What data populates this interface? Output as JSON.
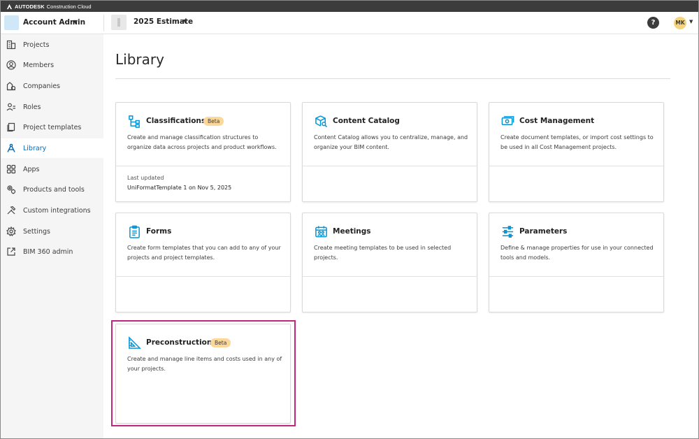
{
  "brand": {
    "name": "AUTODESK",
    "product": "Construction Cloud"
  },
  "header": {
    "account_name": "Account Admin",
    "project_name": "2025 Estimate",
    "help_label": "?",
    "user_initials": "MK"
  },
  "sidebar": {
    "items": [
      {
        "label": "Projects",
        "icon": "building-icon",
        "active": false
      },
      {
        "label": "Members",
        "icon": "person-circle-icon",
        "active": false
      },
      {
        "label": "Companies",
        "icon": "companies-icon",
        "active": false
      },
      {
        "label": "Roles",
        "icon": "roles-icon",
        "active": false
      },
      {
        "label": "Project templates",
        "icon": "template-icon",
        "active": false
      },
      {
        "label": "Library",
        "icon": "library-icon",
        "active": true
      },
      {
        "label": "Apps",
        "icon": "apps-grid-icon",
        "active": false
      },
      {
        "label": "Products and tools",
        "icon": "gear-tools-icon",
        "active": false
      },
      {
        "label": "Custom integrations",
        "icon": "hammer-wrench-icon",
        "active": false
      },
      {
        "label": "Settings",
        "icon": "gear-icon",
        "active": false
      },
      {
        "label": "BIM 360 admin",
        "icon": "external-link-icon",
        "active": false
      }
    ]
  },
  "main": {
    "title": "Library",
    "cards": [
      {
        "title": "Classifications",
        "badge": "Beta",
        "description": "Create and manage classification structures to organize data across projects and product workflows.",
        "meta_label": "Last updated",
        "meta_value": "UniFormatTemplate 1 on Nov 5, 2025",
        "icon": "hierarchy-icon"
      },
      {
        "title": "Content Catalog",
        "badge": "",
        "description": "Content Catalog allows you to centralize, manage, and organize your BIM content.",
        "meta_label": "",
        "meta_value": "",
        "icon": "cube-search-icon"
      },
      {
        "title": "Cost Management",
        "badge": "",
        "description": "Create document templates, or import cost settings to be used in all Cost Management projects.",
        "meta_label": "",
        "meta_value": "",
        "icon": "money-icon"
      },
      {
        "title": "Forms",
        "badge": "",
        "description": "Create form templates that you can add to any of your projects and project templates.",
        "meta_label": "",
        "meta_value": "",
        "icon": "clipboard-icon"
      },
      {
        "title": "Meetings",
        "badge": "",
        "description": "Create meeting templates to be used in selected projects.",
        "meta_label": "",
        "meta_value": "",
        "icon": "calendar-people-icon"
      },
      {
        "title": "Parameters",
        "badge": "",
        "description": "Define & manage properties for use in your connected tools and models.",
        "meta_label": "",
        "meta_value": "",
        "icon": "sliders-icon"
      },
      {
        "title": "Preconstruction",
        "badge": "Beta",
        "description": "Create and manage line items and costs used in any of your projects.",
        "meta_label": "",
        "meta_value": "",
        "icon": "triangle-ruler-icon"
      }
    ]
  },
  "colors": {
    "accent": "#0696d7",
    "active_text": "#0a6ab0",
    "badge": "#fbd89a",
    "highlight": "#c0267a"
  }
}
